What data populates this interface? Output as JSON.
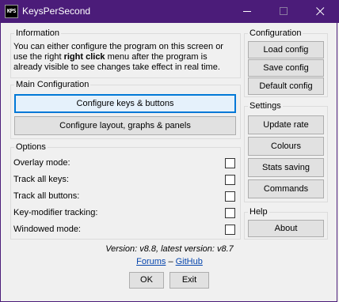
{
  "window": {
    "icon_text": "KPS",
    "title": "KeysPerSecond"
  },
  "information": {
    "legend": "Information",
    "line1": "You can either configure the program on this screen or",
    "line2_pre": "use the right ",
    "line2_bold": "right click",
    "line2_post": " menu after the program is",
    "line3": "already visible to see changes take effect in real time."
  },
  "main_config": {
    "legend": "Main Configuration",
    "keys_button": "Configure keys & buttons",
    "layout_button": "Configure layout, graphs & panels"
  },
  "options": {
    "legend": "Options",
    "items": [
      {
        "label": "Overlay mode:",
        "checked": false
      },
      {
        "label": "Track all keys:",
        "checked": false
      },
      {
        "label": "Track all buttons:",
        "checked": false
      },
      {
        "label": "Key-modifier tracking:",
        "checked": false
      },
      {
        "label": "Windowed mode:",
        "checked": false
      }
    ]
  },
  "configuration": {
    "legend": "Configuration",
    "load": "Load config",
    "save": "Save config",
    "default": "Default config"
  },
  "settings": {
    "legend": "Settings",
    "update_rate": "Update rate",
    "colours": "Colours",
    "stats_saving": "Stats saving",
    "commands": "Commands"
  },
  "help": {
    "legend": "Help",
    "about": "About"
  },
  "footer": {
    "version": "Version: v8.8, latest version: v8.7",
    "forums": "Forums",
    "separator": " – ",
    "github": "GitHub",
    "ok": "OK",
    "exit": "Exit"
  },
  "colors": {
    "titlebar": "#4b1c79",
    "accent": "#0078d7"
  }
}
